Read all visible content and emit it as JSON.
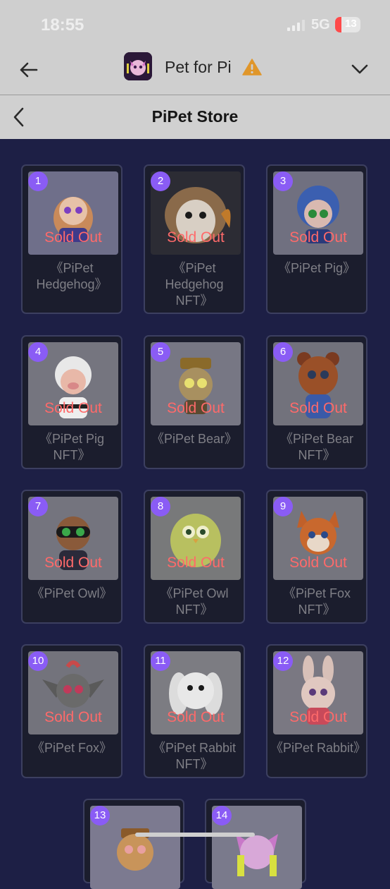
{
  "status": {
    "time": "18:55",
    "network": "5G",
    "battery": "13"
  },
  "app": {
    "title": "Pet for Pi"
  },
  "store": {
    "title": "PiPet Store"
  },
  "colors": {
    "accent": "#8a5cf5",
    "sold_out": "#ff6a6a",
    "background": "#1d1f45"
  },
  "items": [
    {
      "num": "1",
      "status": "Sold Out",
      "name": "《PiPet Hedgehog》"
    },
    {
      "num": "2",
      "status": "Sold Out",
      "name": "《PiPet Hedgehog NFT》"
    },
    {
      "num": "3",
      "status": "Sold Out",
      "name": "《PiPet Pig》"
    },
    {
      "num": "4",
      "status": "Sold Out",
      "name": "《PiPet Pig NFT》"
    },
    {
      "num": "5",
      "status": "Sold Out",
      "name": "《PiPet Bear》"
    },
    {
      "num": "6",
      "status": "Sold Out",
      "name": "《PiPet Bear NFT》"
    },
    {
      "num": "7",
      "status": "Sold Out",
      "name": "《PiPet Owl》"
    },
    {
      "num": "8",
      "status": "Sold Out",
      "name": "《PiPet Owl NFT》"
    },
    {
      "num": "9",
      "status": "Sold Out",
      "name": "《PiPet Fox NFT》"
    },
    {
      "num": "10",
      "status": "Sold Out",
      "name": "《PiPet Fox》"
    },
    {
      "num": "11",
      "status": "Sold Out",
      "name": "《PiPet Rabbit NFT》"
    },
    {
      "num": "12",
      "status": "Sold Out",
      "name": "《PiPet Rabbit》"
    },
    {
      "num": "13"
    },
    {
      "num": "14"
    }
  ]
}
